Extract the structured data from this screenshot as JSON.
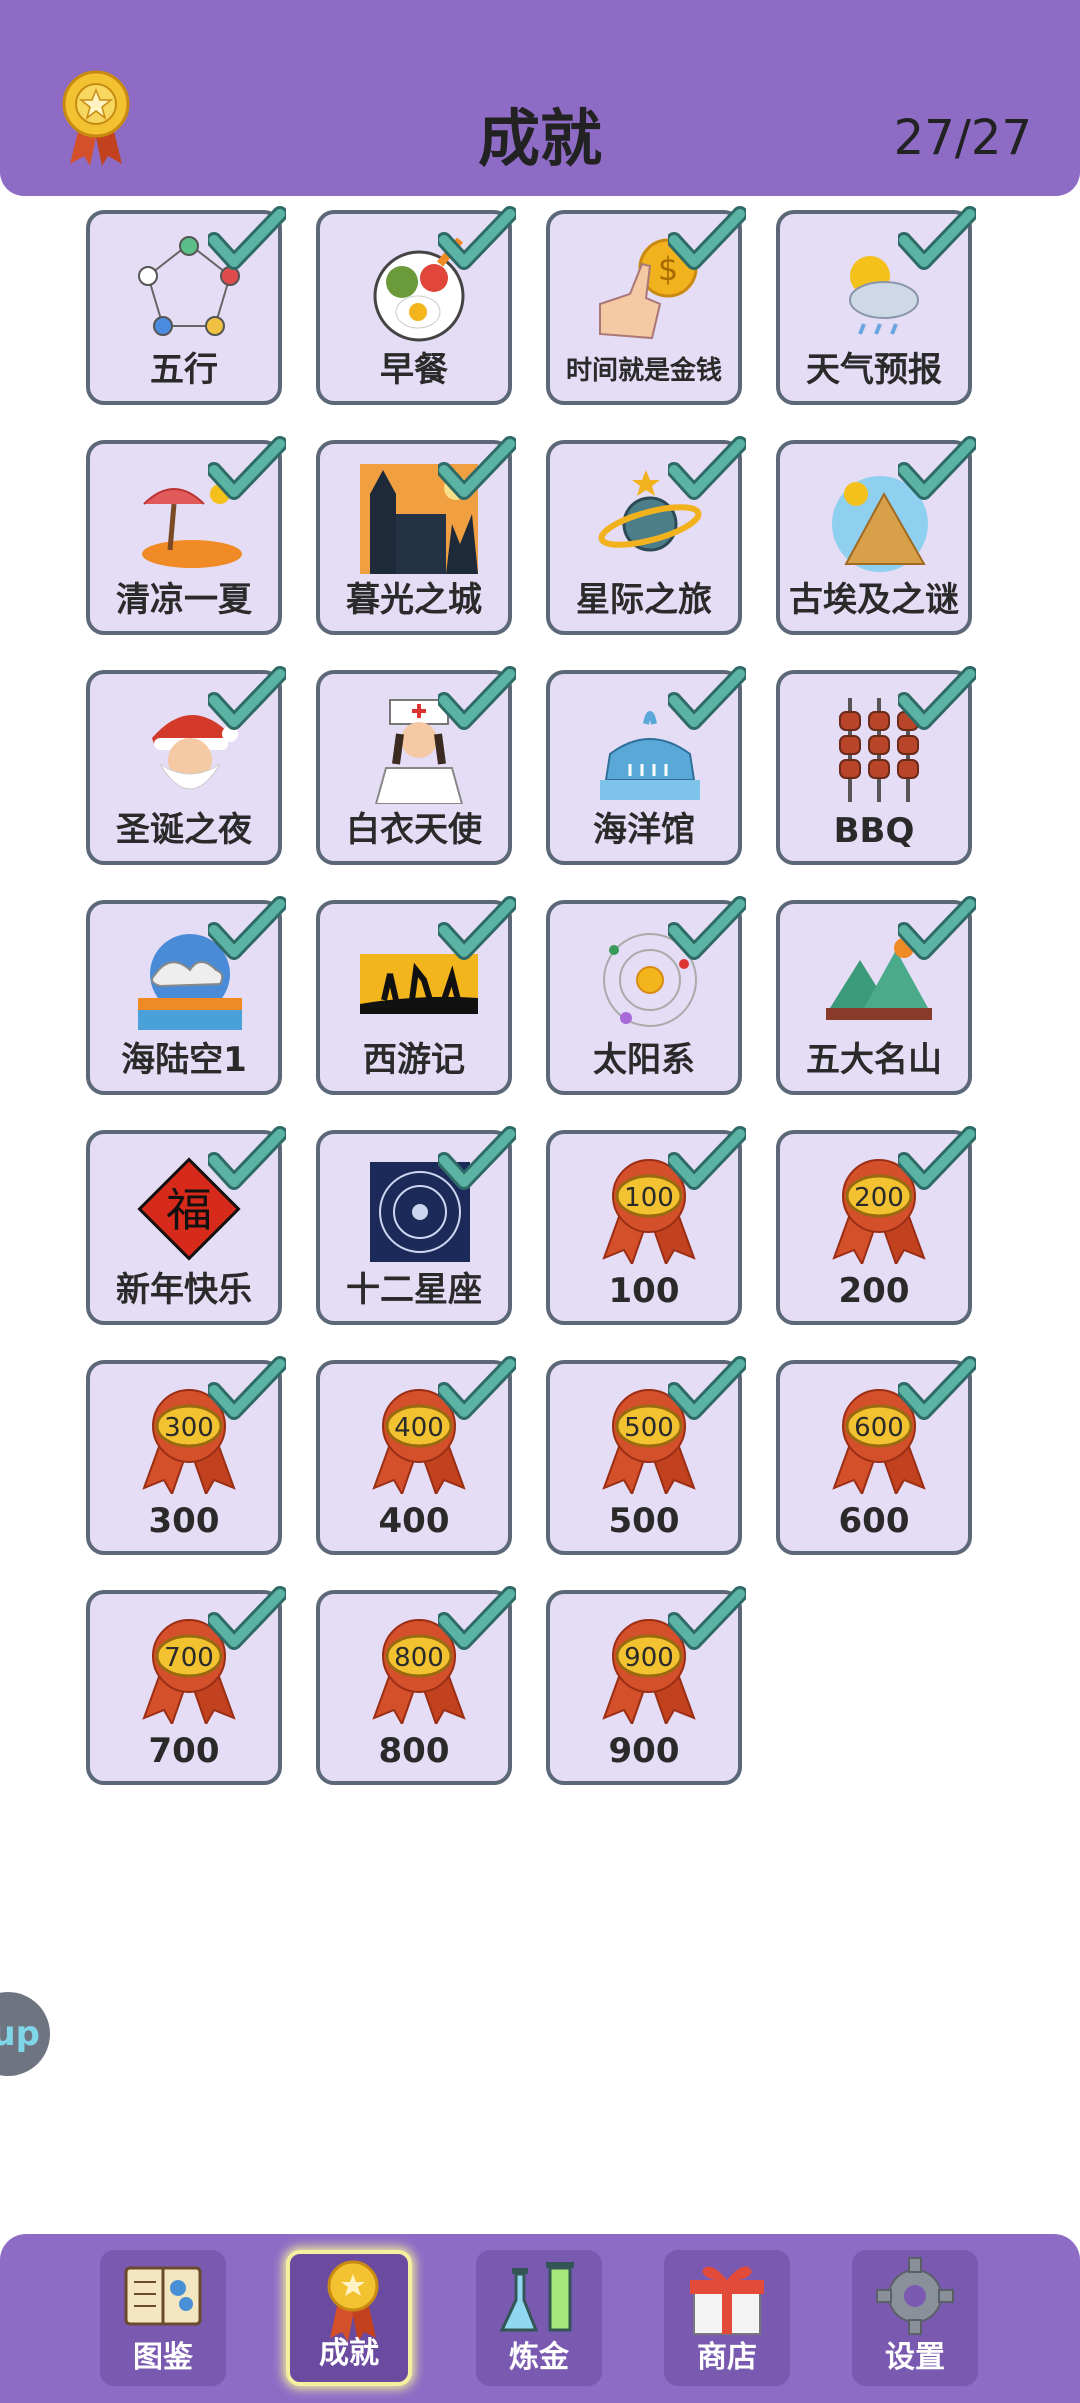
{
  "header": {
    "title": "成就",
    "progress": "27/27"
  },
  "achievements": [
    {
      "label": "五行",
      "icon": "five-elements-icon"
    },
    {
      "label": "早餐",
      "icon": "breakfast-plate-icon"
    },
    {
      "label": "时间就是金钱",
      "icon": "hand-coin-icon"
    },
    {
      "label": "天气预报",
      "icon": "weather-icon"
    },
    {
      "label": "清凉一夏",
      "icon": "beach-island-icon"
    },
    {
      "label": "暮光之城",
      "icon": "twilight-castle-icon"
    },
    {
      "label": "星际之旅",
      "icon": "planet-icon"
    },
    {
      "label": "古埃及之谜",
      "icon": "pyramid-icon"
    },
    {
      "label": "圣诞之夜",
      "icon": "santa-icon"
    },
    {
      "label": "白衣天使",
      "icon": "nurse-icon"
    },
    {
      "label": "海洋馆",
      "icon": "whale-icon"
    },
    {
      "label": "BBQ",
      "icon": "skewers-icon"
    },
    {
      "label": "海陆空1",
      "icon": "sea-land-sky-icon"
    },
    {
      "label": "西游记",
      "icon": "journey-west-icon"
    },
    {
      "label": "太阳系",
      "icon": "solar-system-icon"
    },
    {
      "label": "五大名山",
      "icon": "mountains-icon"
    },
    {
      "label": "新年快乐",
      "icon": "fu-character-icon",
      "badge": "福"
    },
    {
      "label": "十二星座",
      "icon": "zodiac-wheel-icon"
    },
    {
      "label": "100",
      "icon": "rosette-badge-icon",
      "badge": "100"
    },
    {
      "label": "200",
      "icon": "rosette-badge-icon",
      "badge": "200"
    },
    {
      "label": "300",
      "icon": "rosette-badge-icon",
      "badge": "300"
    },
    {
      "label": "400",
      "icon": "rosette-badge-icon",
      "badge": "400"
    },
    {
      "label": "500",
      "icon": "rosette-badge-icon",
      "badge": "500"
    },
    {
      "label": "600",
      "icon": "rosette-badge-icon",
      "badge": "600"
    },
    {
      "label": "700",
      "icon": "rosette-badge-icon",
      "badge": "700"
    },
    {
      "label": "800",
      "icon": "rosette-badge-icon",
      "badge": "800"
    },
    {
      "label": "900",
      "icon": "rosette-badge-icon",
      "badge": "900"
    }
  ],
  "help_button": {
    "text": "up"
  },
  "nav": [
    {
      "label": "图鉴",
      "icon": "book-icon"
    },
    {
      "label": "成就",
      "icon": "medal-icon",
      "active": true
    },
    {
      "label": "炼金",
      "icon": "flask-icon"
    },
    {
      "label": "商店",
      "icon": "gift-box-icon"
    },
    {
      "label": "设置",
      "icon": "gear-icon"
    }
  ],
  "colors": {
    "header_bg": "#8e6cc6",
    "card_bg": "#e5dcf5",
    "card_border": "#5c6778",
    "check": "#5bb3a4",
    "rosette": "#d4502a",
    "rosette_center": "#f2c230"
  }
}
